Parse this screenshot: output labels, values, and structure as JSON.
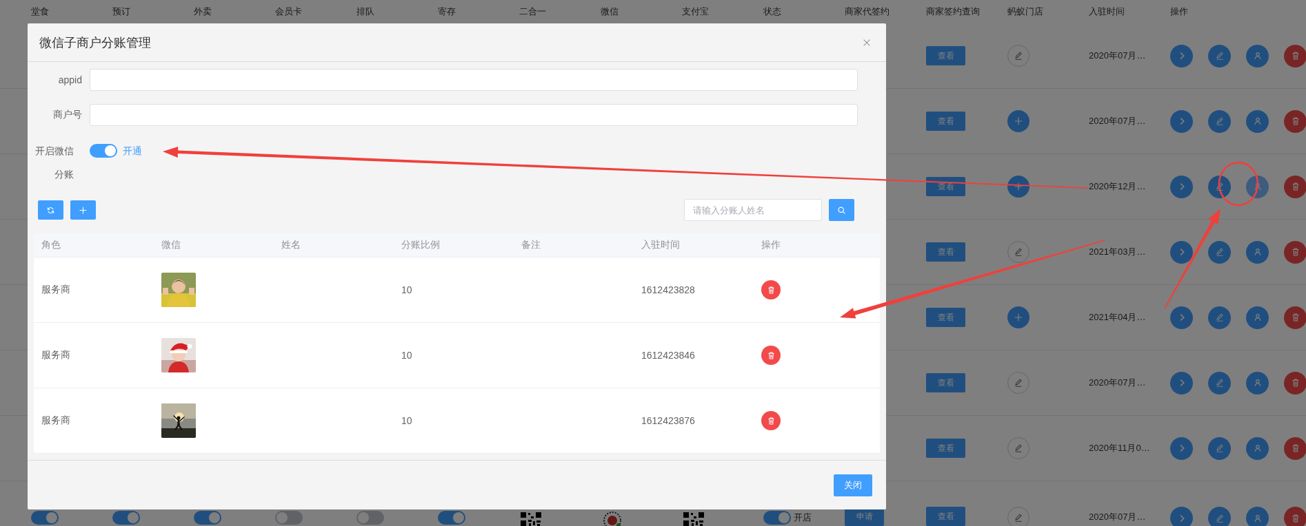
{
  "background_table": {
    "columns": [
      "堂食",
      "预订",
      "外卖",
      "会员卡",
      "排队",
      "寄存",
      "二合一",
      "微信",
      "支付宝",
      "状态",
      "商家代签约",
      "商家签约查询",
      "蚂蚁门店",
      "入驻时间",
      "操作"
    ],
    "row_actions": [
      {
        "kind": "open"
      },
      {
        "kind": "edit"
      },
      {
        "kind": "person"
      },
      {
        "kind": "delete"
      }
    ],
    "rows": [
      {
        "view": "查看",
        "store": {
          "kind": "edit"
        },
        "joined": "2020年07月…",
        "hovered": false
      },
      {
        "view": "查看",
        "store": {
          "kind": "add"
        },
        "joined": "2020年07月…",
        "hovered": false
      },
      {
        "view": "查看",
        "store": {
          "kind": "add"
        },
        "joined": "2020年12月…",
        "hovered": true
      },
      {
        "view": "查看",
        "store": {
          "kind": "edit"
        },
        "joined": "2021年03月…",
        "hovered": false
      },
      {
        "view": "查看",
        "store": {
          "kind": "add"
        },
        "joined": "2021年04月…",
        "hovered": false
      },
      {
        "view": "查看",
        "store": {
          "kind": "edit"
        },
        "joined": "2020年07月…",
        "hovered": false
      },
      {
        "view": "查看",
        "store": {
          "kind": "edit"
        },
        "joined": "2020年11月0…",
        "hovered": false
      },
      {
        "switches": [
          {
            "on": true
          },
          {
            "on": true
          },
          {
            "on": true
          },
          {
            "on": false
          },
          {
            "on": false
          },
          {
            "on": true
          }
        ],
        "codes": [
          {
            "kind": "qr"
          },
          {
            "kind": "mini"
          },
          {
            "kind": "qr"
          }
        ],
        "status": {
          "on": true,
          "label": "开店"
        },
        "sign": "申请",
        "view": "查看",
        "store": {
          "kind": "edit"
        },
        "joined": "2020年07月…",
        "hovered": false
      }
    ]
  },
  "modal": {
    "title": "微信子商户分账管理",
    "fields": [
      {
        "label": "appid"
      },
      {
        "label": "商户号"
      }
    ],
    "switch": {
      "label": "开启微信分账",
      "on": true,
      "text": "开通"
    },
    "toolbar": {
      "buttons": [
        {
          "kind": "refresh"
        },
        {
          "kind": "add"
        }
      ],
      "search": {
        "placeholder": "请输入分账人姓名"
      }
    },
    "table": {
      "columns": [
        "角色",
        "微信",
        "姓名",
        "分账比例",
        "备注",
        "入驻时间",
        "操作"
      ],
      "rows": [
        {
          "role": "服务商",
          "ratio": "10",
          "joined": "1612423828"
        },
        {
          "role": "服务商",
          "ratio": "10",
          "joined": "1612423846"
        },
        {
          "role": "服务商",
          "ratio": "10",
          "joined": "1612423876"
        }
      ]
    },
    "footer": {
      "close": "关闭"
    }
  },
  "annotations": [
    {
      "kind": "arrow"
    },
    {
      "kind": "arrow"
    },
    {
      "kind": "arrow"
    },
    {
      "kind": "circle"
    }
  ]
}
